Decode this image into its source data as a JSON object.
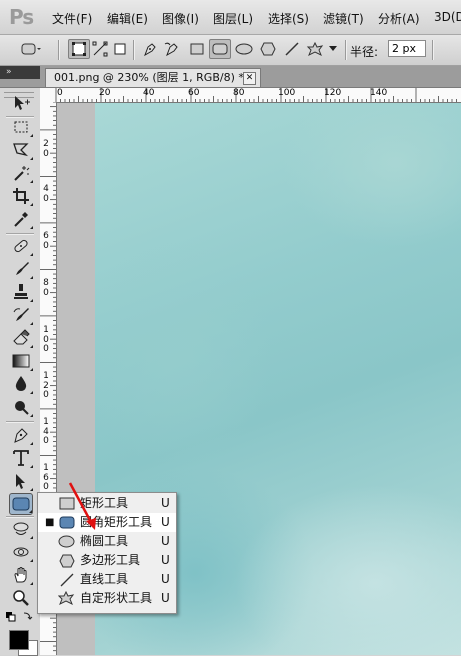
{
  "app": {
    "logo": "Ps"
  },
  "menu": [
    {
      "label": "文件(F)"
    },
    {
      "label": "编辑(E)"
    },
    {
      "label": "图像(I)"
    },
    {
      "label": "图层(L)"
    },
    {
      "label": "选择(S)"
    },
    {
      "label": "滤镜(T)"
    },
    {
      "label": "分析(A)"
    },
    {
      "label": "3D(D"
    }
  ],
  "options": {
    "radius_label": "半径:",
    "radius_value": "2 px"
  },
  "document_tab": {
    "title": "001.png @ 230% (图层 1, RGB/8) *",
    "close_glyph": "✕"
  },
  "panel_collapse_glyph": "»",
  "rulers": {
    "top_labels": [
      "0",
      "20",
      "40",
      "60",
      "80",
      "100",
      "120",
      "140"
    ],
    "left_labels": [
      "2",
      "4",
      "6",
      "8",
      "1",
      "1",
      "1",
      "1"
    ],
    "left_sublabels": [
      "0",
      "0",
      "0",
      "0",
      "0 0",
      "2 0",
      "4 0",
      "6 0"
    ]
  },
  "flyout": {
    "items": [
      {
        "icon": "rectangle-icon",
        "label": "矩形工具",
        "key": "U",
        "selected": false
      },
      {
        "icon": "rounded-rectangle-icon",
        "label": "圆角矩形工具",
        "key": "U",
        "selected": true
      },
      {
        "icon": "ellipse-icon",
        "label": "椭圆工具",
        "key": "U",
        "selected": false
      },
      {
        "icon": "polygon-icon",
        "label": "多边形工具",
        "key": "U",
        "selected": false
      },
      {
        "icon": "line-icon",
        "label": "直线工具",
        "key": "U",
        "selected": false
      },
      {
        "icon": "custom-shape-icon",
        "label": "自定形状工具",
        "key": "U",
        "selected": false
      }
    ],
    "bullet": "■"
  },
  "colors": {
    "accent_active_tool": "#9fb6cc",
    "annotation_arrow": "#e01010",
    "foreground": "#000000",
    "background": "#ffffff"
  }
}
